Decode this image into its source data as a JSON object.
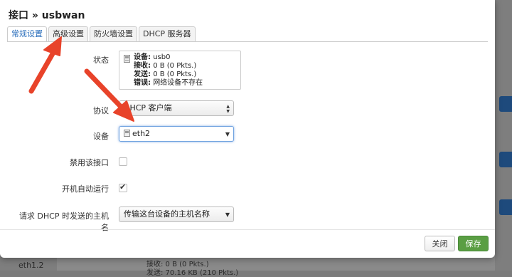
{
  "dialog": {
    "title": "接口 » usbwan",
    "tabs": [
      {
        "label": "常规设置",
        "active": true
      },
      {
        "label": "高级设置",
        "active": false
      },
      {
        "label": "防火墙设置",
        "active": false
      },
      {
        "label": "DHCP 服务器",
        "active": false
      }
    ],
    "status": {
      "label": "状态",
      "device_key": "设备:",
      "device_val": "usb0",
      "rx_key": "接收:",
      "rx_val": "0 B (0 Pkts.)",
      "tx_key": "发送:",
      "tx_val": "0 B (0 Pkts.)",
      "err_key": "错误:",
      "err_val": "网络设备不存在"
    },
    "protocol": {
      "label": "协议",
      "value": "DHCP 客户端"
    },
    "device": {
      "label": "设备",
      "value": "eth2"
    },
    "disable": {
      "label": "禁用该接口",
      "checked": false
    },
    "autostart": {
      "label": "开机自动运行",
      "checked": true
    },
    "hostname": {
      "label": "请求 DHCP 时发送的主机名",
      "value": "传输这台设备的主机名称"
    },
    "buttons": {
      "close": "关闭",
      "save": "保存"
    }
  },
  "background": {
    "iface_name": "eth1.2",
    "rx_partial": "接收: 0 B (0 Pkts.)",
    "tx_partial": "发送: 70.16 KB (210 Pkts.)"
  },
  "colors": {
    "accent_tab": "#2a6ebb",
    "save_button": "#5a9e43",
    "annotation_arrow": "#e8432a"
  }
}
